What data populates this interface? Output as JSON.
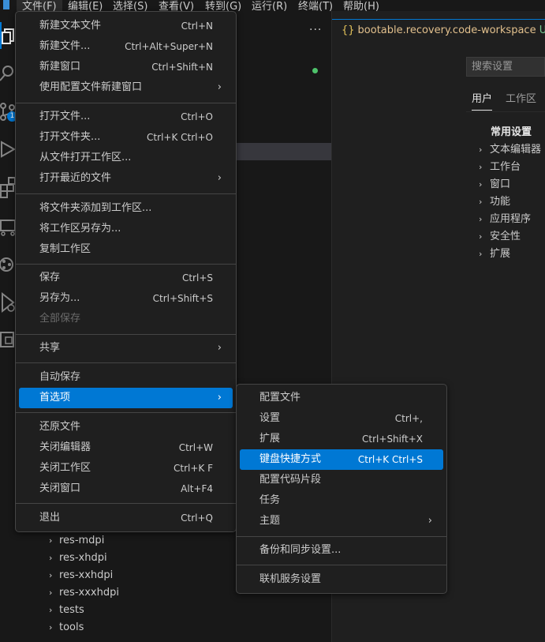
{
  "menubar": {
    "items": [
      "文件(F)",
      "编辑(E)",
      "选择(S)",
      "查看(V)",
      "转到(G)",
      "运行(R)",
      "终端(T)",
      "帮助(H)"
    ]
  },
  "activity": {
    "icons": [
      "explorer-icon",
      "search-icon",
      "source-control-icon",
      "run-debug-icon",
      "extensions-icon",
      "remote-explorer-icon",
      "git-graph-icon",
      "testing-icon",
      "remote-icon"
    ],
    "badge": "1"
  },
  "sidebar": {
    "more": "···",
    "tree": [
      {
        "label": "res-mdpi"
      },
      {
        "label": "res-xhdpi"
      },
      {
        "label": "res-xxhdpi"
      },
      {
        "label": "res-xxxhdpi"
      },
      {
        "label": "tests"
      },
      {
        "label": "tools"
      }
    ]
  },
  "editor": {
    "tab_brace": "{}",
    "tab_label": "bootable.recovery.code-workspace",
    "tab_indicator": "U"
  },
  "settings": {
    "search_placeholder": "搜索设置",
    "tabs": [
      "用户",
      "工作区"
    ],
    "section_title": "常用设置",
    "items": [
      "文本编辑器",
      "工作台",
      "窗口",
      "功能",
      "应用程序",
      "安全性",
      "扩展"
    ]
  },
  "file_menu": {
    "groups": [
      [
        {
          "label": "新建文本文件",
          "key": "Ctrl+N"
        },
        {
          "label": "新建文件...",
          "key": "Ctrl+Alt+Super+N"
        },
        {
          "label": "新建窗口",
          "key": "Ctrl+Shift+N"
        },
        {
          "label": "使用配置文件新建窗口",
          "key": "",
          "submenu": true
        }
      ],
      [
        {
          "label": "打开文件...",
          "key": "Ctrl+O"
        },
        {
          "label": "打开文件夹...",
          "key": "Ctrl+K Ctrl+O"
        },
        {
          "label": "从文件打开工作区...",
          "key": ""
        },
        {
          "label": "打开最近的文件",
          "key": "",
          "submenu": true
        }
      ],
      [
        {
          "label": "将文件夹添加到工作区...",
          "key": ""
        },
        {
          "label": "将工作区另存为...",
          "key": ""
        },
        {
          "label": "复制工作区",
          "key": ""
        }
      ],
      [
        {
          "label": "保存",
          "key": "Ctrl+S"
        },
        {
          "label": "另存为...",
          "key": "Ctrl+Shift+S"
        },
        {
          "label": "全部保存",
          "key": "",
          "disabled": true
        }
      ],
      [
        {
          "label": "共享",
          "key": "",
          "submenu": true
        }
      ],
      [
        {
          "label": "自动保存",
          "key": ""
        },
        {
          "label": "首选项",
          "key": "",
          "submenu": true,
          "highlighted": true
        }
      ],
      [
        {
          "label": "还原文件",
          "key": ""
        },
        {
          "label": "关闭编辑器",
          "key": "Ctrl+W"
        },
        {
          "label": "关闭工作区",
          "key": "Ctrl+K F"
        },
        {
          "label": "关闭窗口",
          "key": "Alt+F4"
        }
      ],
      [
        {
          "label": "退出",
          "key": "Ctrl+Q"
        }
      ]
    ]
  },
  "prefs_menu": {
    "groups": [
      [
        {
          "label": "配置文件",
          "key": ""
        },
        {
          "label": "设置",
          "key": "Ctrl+,"
        },
        {
          "label": "扩展",
          "key": "Ctrl+Shift+X"
        },
        {
          "label": "键盘快捷方式",
          "key": "Ctrl+K Ctrl+S",
          "highlighted": true
        },
        {
          "label": "配置代码片段",
          "key": ""
        },
        {
          "label": "任务",
          "key": ""
        },
        {
          "label": "主题",
          "key": "",
          "submenu": true
        }
      ],
      [
        {
          "label": "备份和同步设置...",
          "key": ""
        }
      ],
      [
        {
          "label": "联机服务设置",
          "key": ""
        }
      ]
    ]
  }
}
